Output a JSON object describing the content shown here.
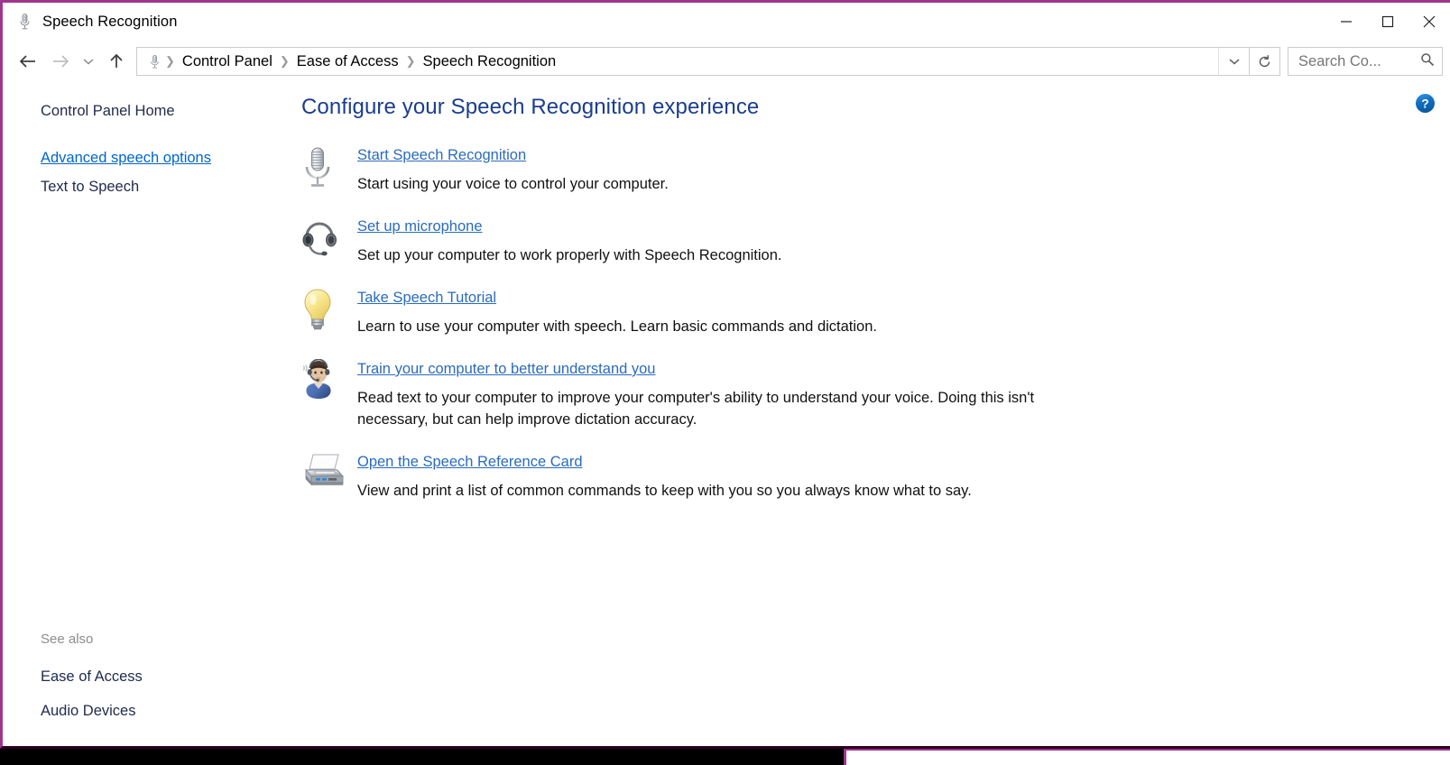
{
  "window": {
    "title": "Speech Recognition",
    "title_icon": "microphone-icon",
    "minimize_label": "—",
    "maximize_label": "❑",
    "close_label": "✕"
  },
  "nav": {
    "back_label": "←",
    "forward_label": "→",
    "recent_label": "⌄",
    "up_label": "↑",
    "refresh_label": "↻",
    "dropdown_label": "⌄",
    "breadcrumbs": [
      {
        "label": "Control Panel"
      },
      {
        "label": "Ease of Access"
      },
      {
        "label": "Speech Recognition"
      }
    ],
    "separator": "❯"
  },
  "search": {
    "placeholder": "Search Co...",
    "value": "",
    "icon": "search-icon"
  },
  "sidebar": {
    "home_label": "Control Panel Home",
    "links": [
      {
        "label": "Advanced speech options",
        "state": "hover"
      },
      {
        "label": "Text to Speech",
        "state": "normal"
      }
    ],
    "see_also_title": "See also",
    "see_also": [
      {
        "label": "Ease of Access"
      },
      {
        "label": "Audio Devices"
      }
    ]
  },
  "main": {
    "page_title": "Configure your Speech Recognition experience",
    "help_label": "?",
    "tasks": [
      {
        "icon": "microphone-icon",
        "link": "Start Speech Recognition",
        "desc": "Start using your voice to control your computer."
      },
      {
        "icon": "headset-icon",
        "link": "Set up microphone",
        "desc": "Set up your computer to work properly with Speech Recognition."
      },
      {
        "icon": "lightbulb-icon",
        "link": "Take Speech Tutorial",
        "desc": "Learn to use your computer with speech.  Learn basic commands and dictation."
      },
      {
        "icon": "person-headset-icon",
        "link": "Train your computer to better understand you",
        "desc": "Read text to your computer to improve your computer's ability to understand your voice.  Doing this isn't necessary, but can help improve dictation accuracy."
      },
      {
        "icon": "printer-icon",
        "link": "Open the Speech Reference Card",
        "desc": "View and print a list of common commands to keep with you so you always know what to say."
      }
    ]
  },
  "colors": {
    "window_border": "#a0368c",
    "title_blue": "#1b3d8f",
    "link_blue": "#2a6bbd",
    "hover_link": "#0066cc",
    "help_blue": "#0f6cbd"
  }
}
